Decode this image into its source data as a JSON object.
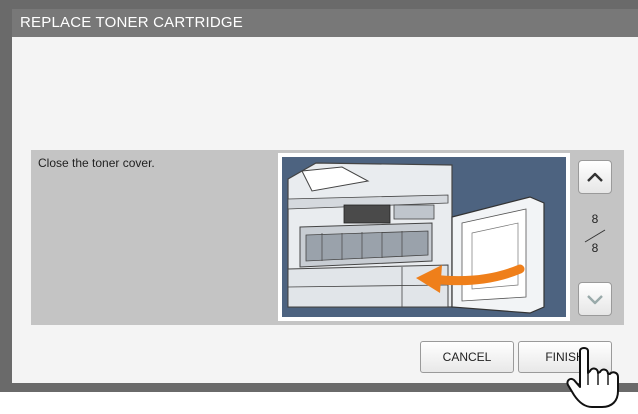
{
  "window": {
    "title": "REPLACE TONER CARTRIDGE"
  },
  "instruction": "Close the toner cover.",
  "pagination": {
    "current": "8",
    "total": "8"
  },
  "buttons": {
    "cancel": "CANCEL",
    "finish": "FINISH"
  },
  "icons": {
    "up": "chevron-up-icon",
    "down": "chevron-down-icon",
    "pointer": "hand-pointer-icon"
  },
  "colors": {
    "frame": "#6a6a6a",
    "panel": "#f4f4f4",
    "content": "#c4c4c4",
    "illustration_bg": "#4d6380",
    "arrow": "#ef7f1a"
  }
}
